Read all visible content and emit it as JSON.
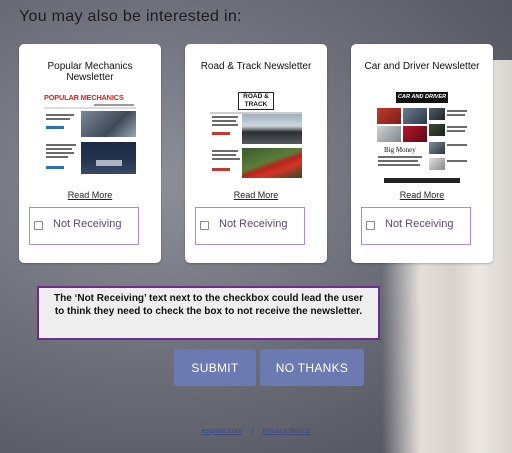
{
  "heading": "You may also be interested in:",
  "cards": [
    {
      "title": "Popular Mechanics Newsletter",
      "masthead": "POPULAR MECHANICS",
      "read_more": "Read More",
      "status": "Not Receiving"
    },
    {
      "title": "Road & Track Newsletter",
      "masthead": "ROAD & TRACK",
      "read_more": "Read More",
      "status": "Not Receiving"
    },
    {
      "title": "Car and Driver Newsletter",
      "masthead": "CAR AND DRIVER",
      "read_more": "Read More",
      "status": "Not Receiving",
      "feature": "Big Money"
    }
  ],
  "annotation": "The ‘Not Receiving’ text next to the checkbox could lead the user to think they need to check the box to not receive the newsletter.",
  "buttons": {
    "submit": "SUBMIT",
    "no_thanks": "NO THANKS"
  },
  "footer": {
    "site_link": "esquire.com",
    "separator": "|",
    "privacy_link": "Privacy Notice"
  },
  "colors": {
    "button": "#6b7bb1",
    "checkbox_border": "#b289c9",
    "annotation_border": "#6d2d8f"
  }
}
